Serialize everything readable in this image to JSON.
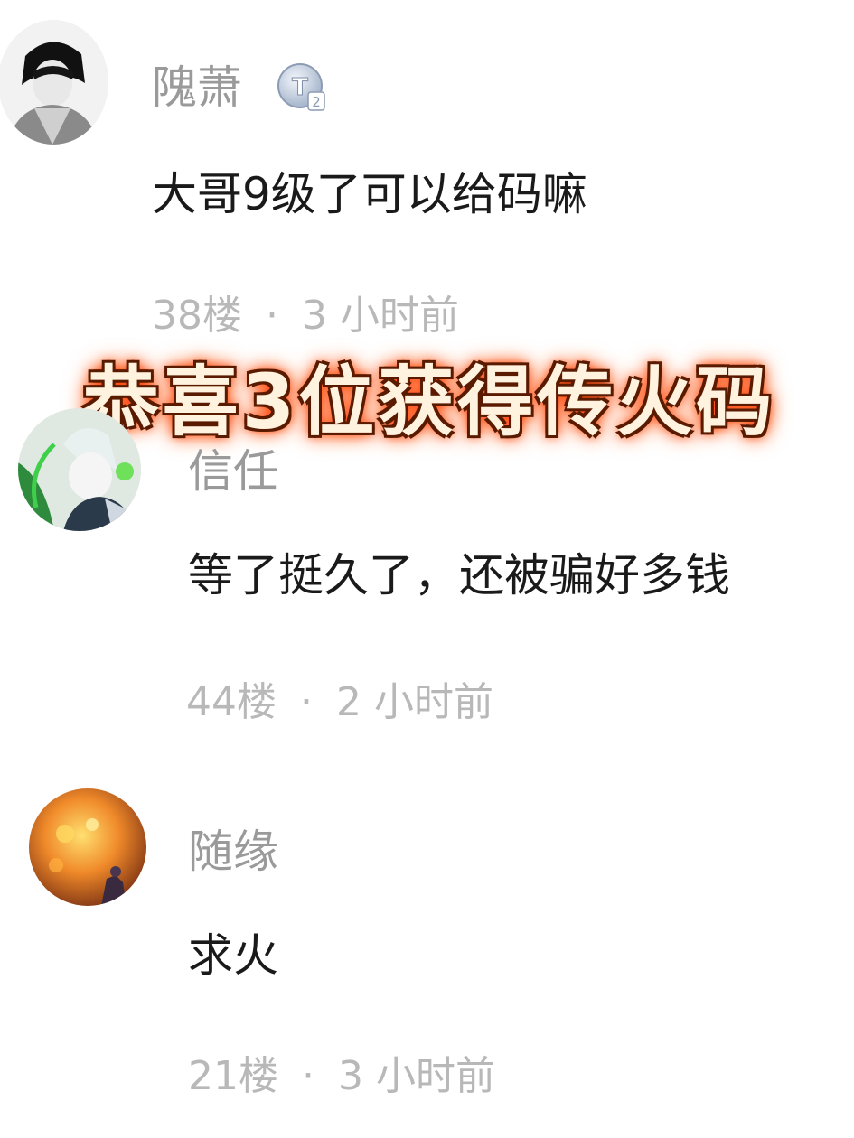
{
  "banner": {
    "text": "恭喜3位获得传火码"
  },
  "comments": [
    {
      "username": "隗萧",
      "badge": "T2",
      "content": "大哥9级了可以给码嘛",
      "floor": "38楼",
      "separator": "·",
      "time": "3 小时前"
    },
    {
      "username": "信任",
      "content": "等了挺久了，还被骗好多钱",
      "floor": "44楼",
      "separator": "·",
      "time": "2 小时前"
    },
    {
      "username": "随缘",
      "content": "求火",
      "floor": "21楼",
      "separator": "·",
      "time": "3 小时前"
    }
  ],
  "colors": {
    "username": "#9a9a9a",
    "content": "#1a1a1a",
    "meta": "#b8b8b8",
    "banner_text": "#fff2df",
    "banner_glow": "#ff4a00"
  },
  "icons": {
    "badge": "level-badge-icon"
  }
}
